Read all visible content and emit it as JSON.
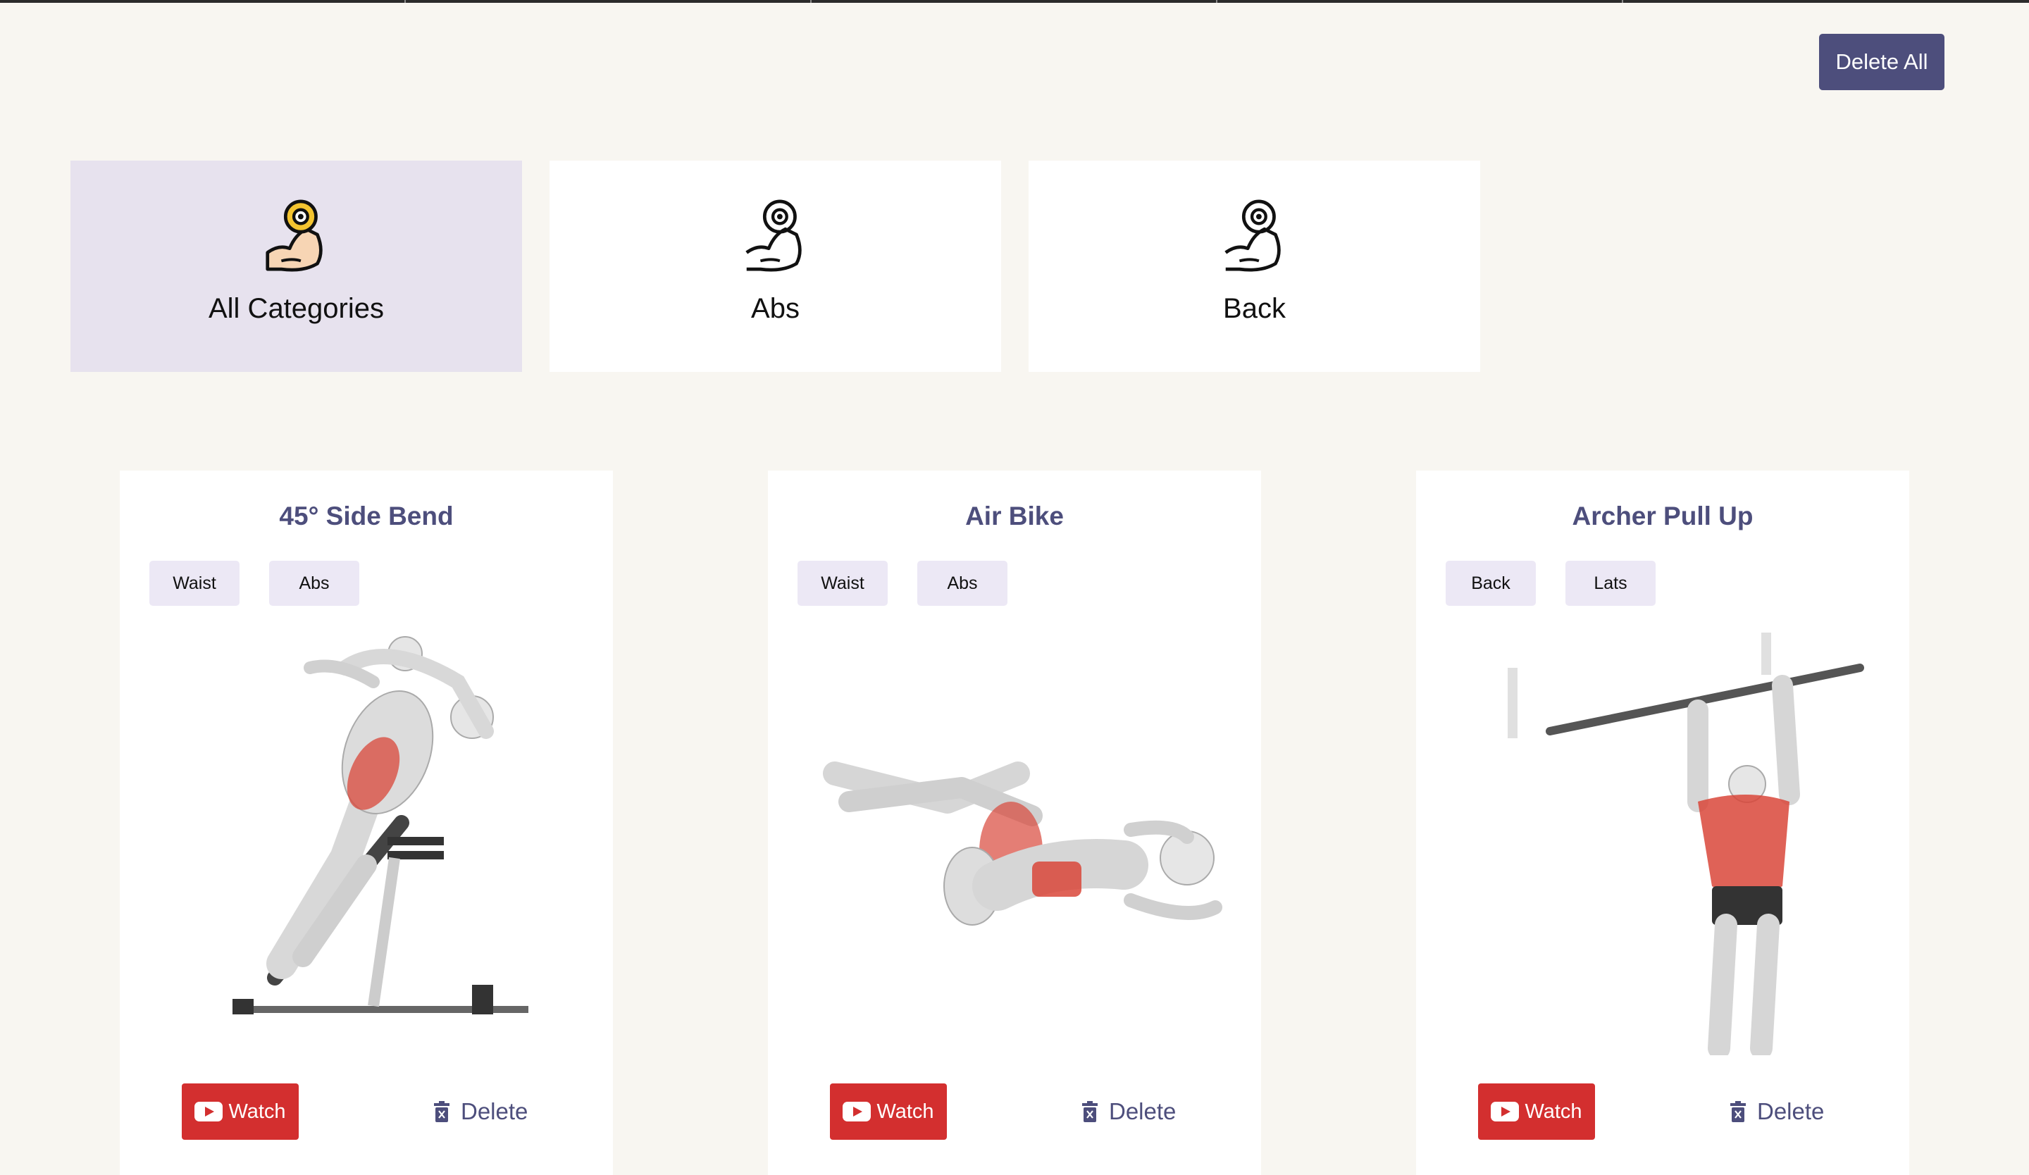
{
  "header": {
    "delete_all_label": "Delete All"
  },
  "categories": [
    {
      "label": "All Categories",
      "icon": "flexed-bicep-dumbbell-icon",
      "active": true
    },
    {
      "label": "Abs",
      "icon": "flexed-bicep-dumbbell-icon",
      "active": false
    },
    {
      "label": "Back",
      "icon": "flexed-bicep-dumbbell-icon",
      "active": false
    }
  ],
  "exercises": [
    {
      "title": "45° Side Bend",
      "tags": [
        "Waist",
        "Abs"
      ],
      "watch_label": "Watch",
      "delete_label": "Delete",
      "image": "side-bend-illustration"
    },
    {
      "title": "Air Bike",
      "tags": [
        "Waist",
        "Abs"
      ],
      "watch_label": "Watch",
      "delete_label": "Delete",
      "image": "air-bike-illustration"
    },
    {
      "title": "Archer Pull Up",
      "tags": [
        "Back",
        "Lats"
      ],
      "watch_label": "Watch",
      "delete_label": "Delete",
      "image": "archer-pull-up-illustration"
    }
  ],
  "colors": {
    "accent": "#4d4e7c",
    "watch_red": "#d32f2f",
    "tag_bg": "#ece8f5",
    "active_category_bg": "#e7e2ee",
    "page_bg": "#f8f6f1",
    "muscle_red": "#d9473a"
  }
}
